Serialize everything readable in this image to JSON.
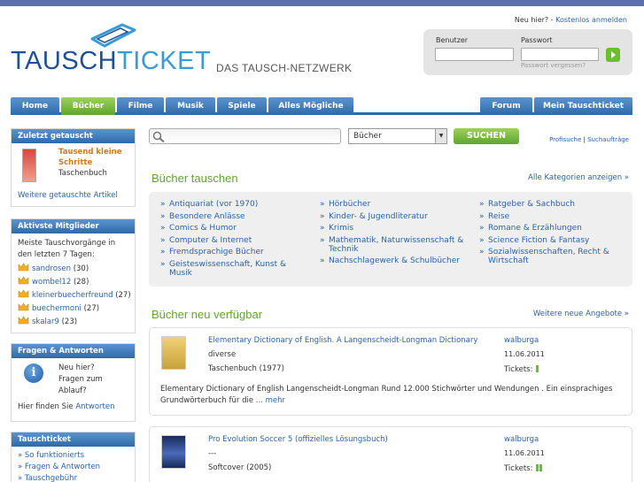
{
  "header": {
    "logo_part1": "TAUSCH",
    "logo_part2": "TICKET",
    "tagline": "DAS TAUSCH-NETZWERK",
    "new_here": "Neu hier? -",
    "register_link": "Kostenlos anmelden"
  },
  "login": {
    "user_label": "Benutzer",
    "password_label": "Passwort",
    "forgot_link": "Passwort vergessen?",
    "submit_icon": "arrow-right-icon"
  },
  "nav": {
    "left": [
      "Home",
      "Bücher",
      "Filme",
      "Musik",
      "Spiele",
      "Alles Mögliche"
    ],
    "right": [
      "Forum",
      "Mein Tauschticket"
    ],
    "active": "Bücher"
  },
  "sidebar": {
    "recent": {
      "heading": "Zuletzt getauscht",
      "title": "Tausend kleine Schritte",
      "format": "Taschenbuch",
      "more_link": "Weitere getauschte Artikel"
    },
    "members": {
      "heading": "Aktivste Mitglieder",
      "intro": "Meiste Tauschvorgänge in den letzten 7 Tagen:",
      "list": [
        {
          "name": "sandrosen",
          "count": "(30)"
        },
        {
          "name": "wombel12",
          "count": "(28)"
        },
        {
          "name": "kleinerbuecherfreund",
          "count": "(27)"
        },
        {
          "name": "buechermoni",
          "count": "(27)"
        },
        {
          "name": "skalar9",
          "count": "(23)"
        }
      ]
    },
    "faq": {
      "heading": "Fragen & Antworten",
      "line1": "Neu hier?",
      "line2": "Fragen zum",
      "line3": "Ablauf?",
      "foot_text": "Hier finden Sie",
      "foot_link": "Antworten"
    },
    "tauschticket": {
      "heading": "Tauschticket",
      "items": [
        "So funktionierts",
        "Fragen & Antworten",
        "Tauschgebühr"
      ]
    }
  },
  "search": {
    "placeholder": "",
    "category": "Bücher",
    "button": "SUCHEN",
    "profi_link": "Profisuche",
    "auftraege_link": "Suchaufträge",
    "separator": "|"
  },
  "categories": {
    "title": "Bücher tauschen",
    "all_link": "Alle Kategorien anzeigen »",
    "col1": [
      "Antiquariat (vor 1970)",
      "Besondere Anlässe",
      "Comics & Humor",
      "Computer & Internet",
      "Fremdsprachige Bücher",
      "Geisteswissenschaft, Kunst & Musik"
    ],
    "col2": [
      "Hörbücher",
      "Kinder- & Jugendliteratur",
      "Krimis",
      "Mathematik, Naturwissenschaft & Technik",
      "Nachschlagewerk & Schulbücher"
    ],
    "col3": [
      "Ratgeber & Sachbuch",
      "Reise",
      "Romane & Erzählungen",
      "Science Fiction & Fantasy",
      "Sozialwissenschaften, Recht & Wirtschaft"
    ]
  },
  "new_items": {
    "title": "Bücher neu verfügbar",
    "more_link": "Weitere neue Angebote »",
    "items": [
      {
        "title": "Elementary Dictionary of English. A Langenscheidt-Longman Dictionary",
        "author": "diverse",
        "format": "Taschenbuch (1977)",
        "user": "walburga",
        "date": "11.06.2011",
        "tickets_label": "Tickets:",
        "tickets": 1,
        "description": "Elementary Dictionary of English Langenscheidt-Longman Rund 12.000 Stichwörter und Wendungen . Ein einsprachiges Grundwörterbuch für die",
        "more": "... mehr"
      },
      {
        "title": "Pro Evolution Soccer 5 (offizielles Lösungsbuch)",
        "author": "---",
        "format": "Softcover (2005)",
        "user": "walburga",
        "date": "11.06.2011",
        "tickets_label": "Tickets:",
        "tickets": 2
      }
    ]
  },
  "colors": {
    "nav_blue": "#2f6aa8",
    "accent_green": "#5fa52c",
    "link_blue": "#2a62a8",
    "top_bar": "#5d6eb0"
  }
}
